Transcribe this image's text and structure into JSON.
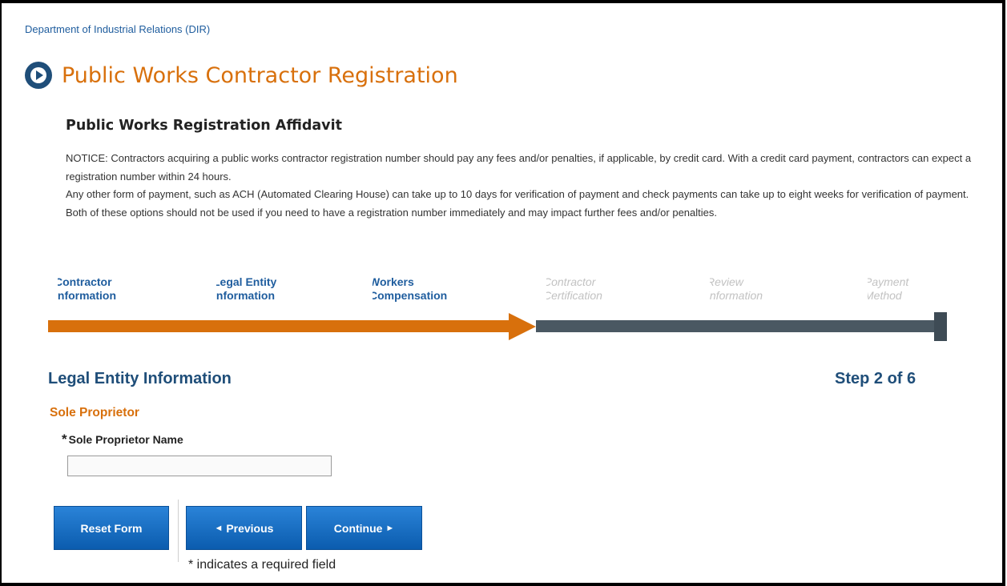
{
  "header": {
    "department_link": "Department of Industrial Relations (DIR)",
    "title": "Public Works Contractor Registration",
    "icon": "play-circle-icon",
    "title_color": "#d8700c"
  },
  "affidavit": {
    "title": "Public Works Registration Affidavit",
    "notice_p1": "NOTICE: Contractors acquiring a public works contractor registration number should pay any fees and/or penalties, if applicable, by credit card. With a credit card payment, contractors can expect a registration number within 24 hours.",
    "notice_p2": "Any other form of payment, such as ACH (Automated Clearing House) can take up to 10 days for verification of payment and check payments can take up to eight weeks for verification of payment. Both of these options should not be used if you need to have a registration number immediately and may impact further fees and/or penalties."
  },
  "steps": [
    {
      "line1": "Contractor",
      "line2": "Information",
      "status": "complete"
    },
    {
      "line1": "Legal Entity",
      "line2": "Information",
      "status": "current"
    },
    {
      "line1": "Workers",
      "line2": "Compensation",
      "status": "complete"
    },
    {
      "line1": "Contractor",
      "line2": "Certification",
      "status": "pending"
    },
    {
      "line1": "Review",
      "line2": "Information",
      "status": "pending"
    },
    {
      "line1": "Payment",
      "line2": "Method",
      "status": "pending"
    }
  ],
  "progress": {
    "completed_fraction": 0.5,
    "completed_color": "#d8700c",
    "remaining_color": "#4a5862"
  },
  "form": {
    "section_title": "Legal Entity Information",
    "step_counter": "Step 2 of 6",
    "entity_type": "Sole Proprietor",
    "required_marker": "*",
    "field_label": "Sole Proprietor Name",
    "field_value": ""
  },
  "buttons": {
    "reset": "Reset Form",
    "previous": "Previous",
    "previous_icon": "◄",
    "continue": "Continue",
    "continue_icon": "►"
  },
  "footnote": "* indicates a required field"
}
